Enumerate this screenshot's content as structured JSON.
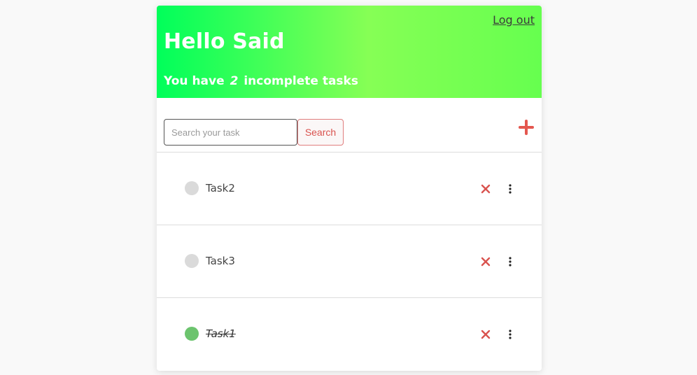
{
  "header": {
    "logout_label": "Log out",
    "greeting": "Hello Said",
    "subtext_before": "You have",
    "incomplete_count": "2",
    "subtext_after": "incomplete tasks"
  },
  "search": {
    "placeholder": "Search your task",
    "value": "",
    "button_label": "Search"
  },
  "add_button": {
    "icon": "plus-icon",
    "color": "#e4574f"
  },
  "tasks": [
    {
      "label": "Task2",
      "completed": false
    },
    {
      "label": "Task3",
      "completed": false
    },
    {
      "label": "Task1",
      "completed": true
    }
  ],
  "icons": {
    "delete": "close-icon",
    "more": "more-vertical-icon"
  },
  "colors": {
    "header_gradient_start": "#00ff5a",
    "header_gradient_end": "#86ff55",
    "accent_red": "#d9534f",
    "done_green": "#6cc46e",
    "pending_gray": "#dadada"
  }
}
